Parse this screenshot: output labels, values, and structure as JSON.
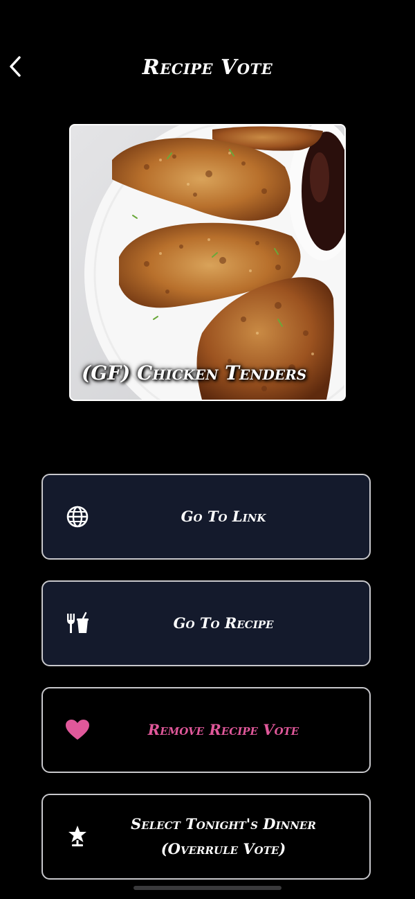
{
  "header": {
    "title": "Recipe Vote",
    "back_icon": "chevron-left-icon"
  },
  "recipe": {
    "name": "(GF) Chicken Tenders"
  },
  "actions": [
    {
      "label": "Go To Link",
      "icon": "globe-icon"
    },
    {
      "label": "Go To Recipe",
      "icon": "fork-knife-cup-icon"
    },
    {
      "label": "Remove Recipe Vote",
      "icon": "heart-icon"
    },
    {
      "label_line1": "Select Tonight's Dinner",
      "label_line2": "(Overrule Vote)",
      "icon": "star-trophy-icon"
    }
  ],
  "colors": {
    "background": "#000000",
    "button_dark": "#141a2c",
    "button_border": "#c8c8cc",
    "accent_pink": "#e0589a"
  }
}
